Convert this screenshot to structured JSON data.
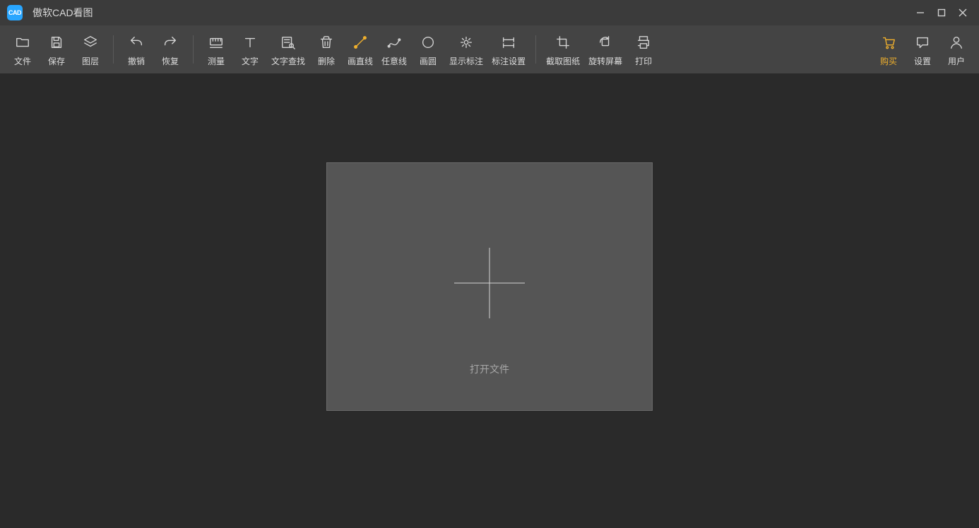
{
  "app": {
    "logo_text": "CAD",
    "title": "傲软CAD看图"
  },
  "toolbar": {
    "groups": [
      [
        {
          "id": "file",
          "label": "文件",
          "icon": "folder-icon"
        },
        {
          "id": "save",
          "label": "保存",
          "icon": "save-icon"
        },
        {
          "id": "layers",
          "label": "图层",
          "icon": "layers-icon"
        }
      ],
      [
        {
          "id": "undo",
          "label": "撤销",
          "icon": "undo-icon"
        },
        {
          "id": "redo",
          "label": "恢复",
          "icon": "redo-icon"
        }
      ],
      [
        {
          "id": "measure",
          "label": "测量",
          "icon": "measure-icon"
        },
        {
          "id": "text",
          "label": "文字",
          "icon": "text-icon"
        },
        {
          "id": "find-text",
          "label": "文字查找",
          "icon": "find-text-icon"
        },
        {
          "id": "delete",
          "label": "删除",
          "icon": "delete-icon"
        },
        {
          "id": "line",
          "label": "画直线",
          "icon": "line-icon",
          "accent_line": true
        },
        {
          "id": "freeline",
          "label": "任意线",
          "icon": "freeline-icon"
        },
        {
          "id": "circle",
          "label": "画圆",
          "icon": "circle-icon"
        },
        {
          "id": "show-annot",
          "label": "显示标注",
          "icon": "show-annot-icon"
        },
        {
          "id": "annot-setting",
          "label": "标注设置",
          "icon": "annot-setting-icon"
        }
      ],
      [
        {
          "id": "crop",
          "label": "截取图纸",
          "icon": "crop-icon"
        },
        {
          "id": "rotate",
          "label": "旋转屏幕",
          "icon": "rotate-icon"
        },
        {
          "id": "print",
          "label": "打印",
          "icon": "print-icon"
        }
      ]
    ],
    "right": [
      {
        "id": "buy",
        "label": "购买",
        "icon": "cart-icon",
        "accent": true
      },
      {
        "id": "settings",
        "label": "设置",
        "icon": "chat-icon"
      },
      {
        "id": "user",
        "label": "用户",
        "icon": "user-icon"
      }
    ]
  },
  "main": {
    "open_file_label": "打开文件"
  },
  "colors": {
    "accent": "#f0b02d",
    "bg_titlebar": "#3b3b3b",
    "bg_toolbar": "#444444",
    "bg_canvas": "#2a2a2a",
    "bg_card": "#555555"
  }
}
